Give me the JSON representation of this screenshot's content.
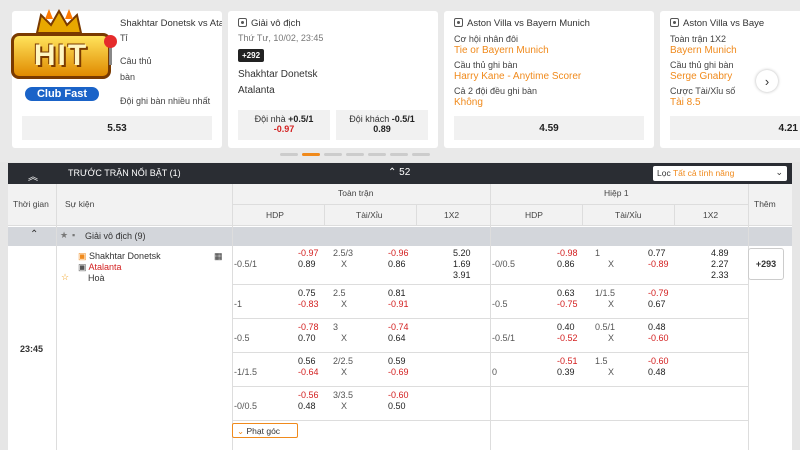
{
  "logo": {
    "text": "HIT",
    "sub": "Club Fast"
  },
  "cards": [
    {
      "title": "Shakhtar Donetsk vs Atalanta",
      "lines": [
        "Tỉ",
        "Câu thủ",
        "bàn",
        "Đội ghi bàn nhiều nhất"
      ],
      "odd": "5.53"
    },
    {
      "title": "Giải vô địch",
      "date": "Thứ Tư, 10/02, 23:45",
      "badge": "+292",
      "team1": "Shakhtar Donetsk",
      "team2": "Atalanta",
      "home_label": "Đội nhà",
      "home_line": "+0.5/1",
      "home_odd": "-0.97",
      "away_label": "Đội khách",
      "away_line": "-0.5/1",
      "away_odd": "0.89"
    },
    {
      "title": "Aston Villa vs Bayern Munich",
      "l1": "Cơ hội nhân đôi",
      "o1": "Tie or Bayern Munich",
      "l2": "Cầu thủ ghi bàn",
      "o2": "Harry Kane - Anytime Scorer",
      "l3": "Cả 2 đội đều ghi bàn",
      "o3": "Không",
      "odd": "4.59"
    },
    {
      "title": "Aston Villa vs Baye",
      "l1": "Toàn trận 1X2",
      "o1": "Bayern Munich",
      "l2": "Cầu thủ ghi bàn",
      "o2": "Serge Gnabry",
      "l3": "Cược Tài/Xỉu số",
      "o3": "Tài 8.5",
      "odd": "4.21"
    }
  ],
  "header": {
    "chev": "︽",
    "title": "Trước trận nổi bật (1)",
    "live_count": "52",
    "filter_label": "Lọc",
    "filter_value": "Tất cả tính năng"
  },
  "columns": {
    "time": "Thời gian",
    "event": "Sự kiện",
    "full": "Toàn trận",
    "half": "Hiệp 1",
    "hdp": "HDP",
    "ou": "Tài/Xỉu",
    "x12": "1X2",
    "more": "Thêm"
  },
  "league": {
    "name": "Giải vô địch (9)"
  },
  "match": {
    "home": "Shakhtar Donetsk",
    "away": "Atalanta",
    "draw": "Hoà",
    "time": "23:45",
    "more": "+293",
    "corner": "Phạt góc"
  },
  "rows": [
    {
      "ft_hdp": "-0.5/1",
      "ft_hdp_a": "-0.97",
      "ft_hdp_b": "0.89",
      "ft_ou": "2.5/3",
      "ft_ou_x": "X",
      "ft_ou_a": "-0.96",
      "ft_ou_b": "0.86",
      "x1": "5.20",
      "x2": "1.69",
      "x3": "3.91",
      "h_hdp": "-0/0.5",
      "h_hdp_a": "-0.98",
      "h_hdp_b": "0.86",
      "h_ou": "1",
      "h_ou_x": "X",
      "h_ou_a": "0.77",
      "h_ou_b": "-0.89",
      "h1": "4.89",
      "h2": "2.27",
      "h3": "2.33"
    },
    {
      "ft_hdp": "-1",
      "ft_hdp_a": "0.75",
      "ft_hdp_b": "-0.83",
      "ft_ou": "2.5",
      "ft_ou_x": "X",
      "ft_ou_a": "0.81",
      "ft_ou_b": "-0.91",
      "h_hdp": "-0.5",
      "h_hdp_a": "0.63",
      "h_hdp_b": "-0.75",
      "h_ou": "1/1.5",
      "h_ou_x": "X",
      "h_ou_a": "-0.79",
      "h_ou_b": "0.67"
    },
    {
      "ft_hdp": "-0.5",
      "ft_hdp_a": "-0.78",
      "ft_hdp_b": "0.70",
      "ft_ou": "3",
      "ft_ou_x": "X",
      "ft_ou_a": "-0.74",
      "ft_ou_b": "0.64",
      "h_hdp": "-0.5/1",
      "h_hdp_a": "0.40",
      "h_hdp_b": "-0.52",
      "h_ou": "0.5/1",
      "h_ou_x": "X",
      "h_ou_a": "0.48",
      "h_ou_b": "-0.60"
    },
    {
      "ft_hdp": "-1/1.5",
      "ft_hdp_a": "0.56",
      "ft_hdp_b": "-0.64",
      "ft_ou": "2/2.5",
      "ft_ou_x": "X",
      "ft_ou_a": "0.59",
      "ft_ou_b": "-0.69",
      "h_hdp": "0",
      "h_hdp_a": "-0.51",
      "h_hdp_b": "0.39",
      "h_ou": "1.5",
      "h_ou_x": "X",
      "h_ou_a": "-0.60",
      "h_ou_b": "0.48"
    },
    {
      "ft_hdp": "-0/0.5",
      "ft_hdp_a": "-0.56",
      "ft_hdp_b": "0.48",
      "ft_ou": "3/3.5",
      "ft_ou_x": "X",
      "ft_ou_a": "-0.60",
      "ft_ou_b": "0.50"
    }
  ]
}
